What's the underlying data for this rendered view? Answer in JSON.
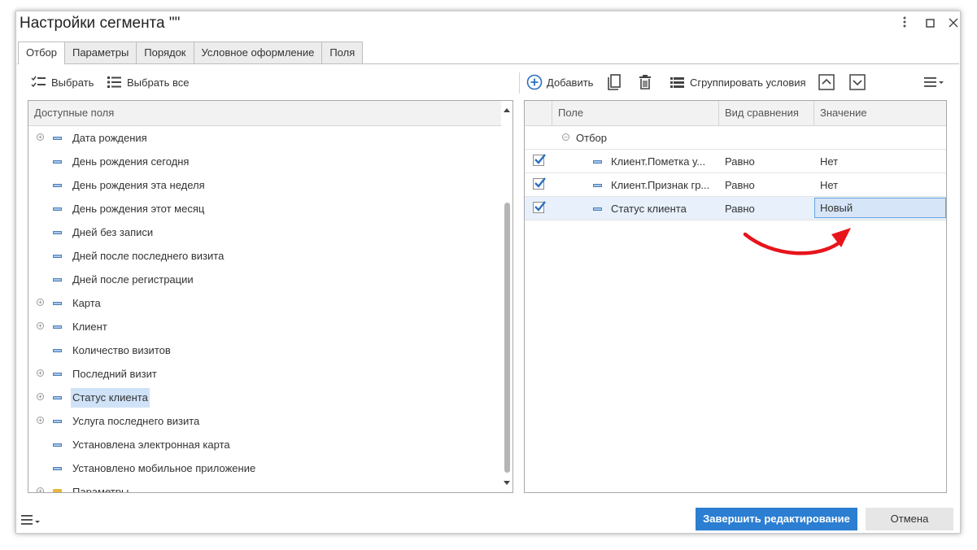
{
  "window": {
    "title": "Настройки сегмента \"\"",
    "more_icon": "more-vertical-icon",
    "maximize_icon": "maximize-icon",
    "close_icon": "close-icon"
  },
  "tabs": [
    {
      "label": "Отбор",
      "active": true
    },
    {
      "label": "Параметры",
      "active": false
    },
    {
      "label": "Порядок",
      "active": false
    },
    {
      "label": "Условное оформление",
      "active": false
    },
    {
      "label": "Поля",
      "active": false
    }
  ],
  "left_toolbar": {
    "select_label": "Выбрать",
    "select_all_label": "Выбрать все"
  },
  "available_fields": {
    "header": "Доступные поля",
    "items": [
      {
        "label": "Дата рождения",
        "expandable": true,
        "icon": "field-icon"
      },
      {
        "label": "День рождения сегодня",
        "expandable": false,
        "icon": "field-icon"
      },
      {
        "label": "День рождения эта неделя",
        "expandable": false,
        "icon": "field-icon"
      },
      {
        "label": "День рождения этот месяц",
        "expandable": false,
        "icon": "field-icon"
      },
      {
        "label": "Дней без записи",
        "expandable": false,
        "icon": "field-icon"
      },
      {
        "label": "Дней после последнего визита",
        "expandable": false,
        "icon": "field-icon"
      },
      {
        "label": "Дней после регистрации",
        "expandable": false,
        "icon": "field-icon"
      },
      {
        "label": "Карта",
        "expandable": true,
        "icon": "field-icon"
      },
      {
        "label": "Клиент",
        "expandable": true,
        "icon": "field-icon"
      },
      {
        "label": "Количество визитов",
        "expandable": false,
        "icon": "field-icon"
      },
      {
        "label": "Последний визит",
        "expandable": true,
        "icon": "field-icon"
      },
      {
        "label": "Статус клиента",
        "expandable": true,
        "icon": "field-icon",
        "selected": true
      },
      {
        "label": "Услуга последнего визита",
        "expandable": true,
        "icon": "field-icon"
      },
      {
        "label": "Установлена электронная карта",
        "expandable": false,
        "icon": "field-icon"
      },
      {
        "label": "Установлено мобильное приложение",
        "expandable": false,
        "icon": "field-icon"
      },
      {
        "label": "Параметры",
        "expandable": true,
        "icon": "folder-icon"
      }
    ]
  },
  "right_toolbar": {
    "add_label": "Добавить",
    "group_label": "Сгруппировать условия"
  },
  "filter_grid": {
    "columns": [
      "Поле",
      "Вид сравнения",
      "Значение"
    ],
    "group_label": "Отбор",
    "rows": [
      {
        "checked": true,
        "field": "Клиент.Пометка у...",
        "comparison": "Равно",
        "value": "Нет"
      },
      {
        "checked": true,
        "field": "Клиент.Признак гр...",
        "comparison": "Равно",
        "value": "Нет"
      },
      {
        "checked": true,
        "field": "Статус клиента",
        "comparison": "Равно",
        "value": "Новый",
        "active": true
      }
    ]
  },
  "footer": {
    "finish_label": "Завершить редактирование",
    "cancel_label": "Отмена"
  },
  "colors": {
    "primary_button": "#2b7ed2",
    "selection": "#cfe2f7",
    "annotation_arrow": "#e8141b"
  }
}
